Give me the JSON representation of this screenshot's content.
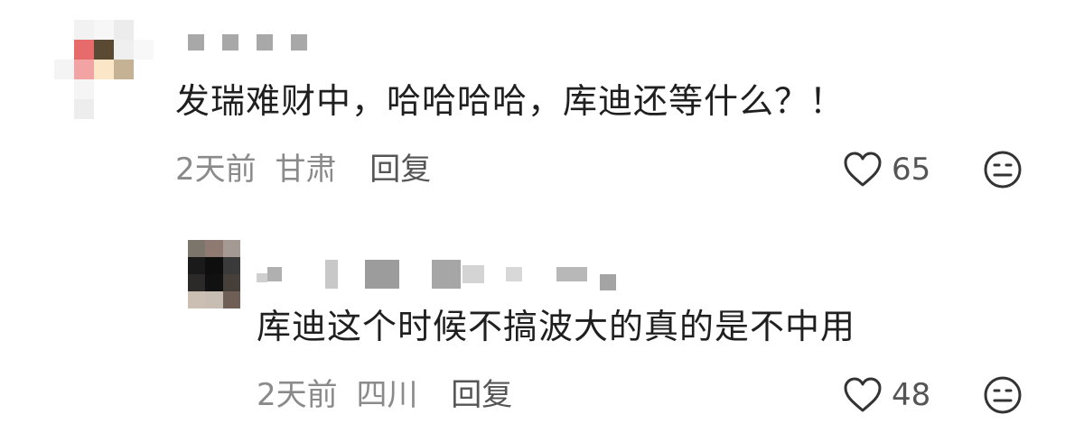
{
  "comments": [
    {
      "text": "发瑞难财中，哈哈哈哈，库迪还等什么？！",
      "time": "2天前",
      "location": "甘肃",
      "reply_label": "回复",
      "likes": "65"
    },
    {
      "text": "库迪这个时候不搞波大的真的是不中用",
      "time": "2天前",
      "location": "四川",
      "reply_label": "回复",
      "likes": "48"
    }
  ],
  "icons": {
    "like": "heart-outline-icon",
    "emoji": "neutral-face-icon"
  }
}
